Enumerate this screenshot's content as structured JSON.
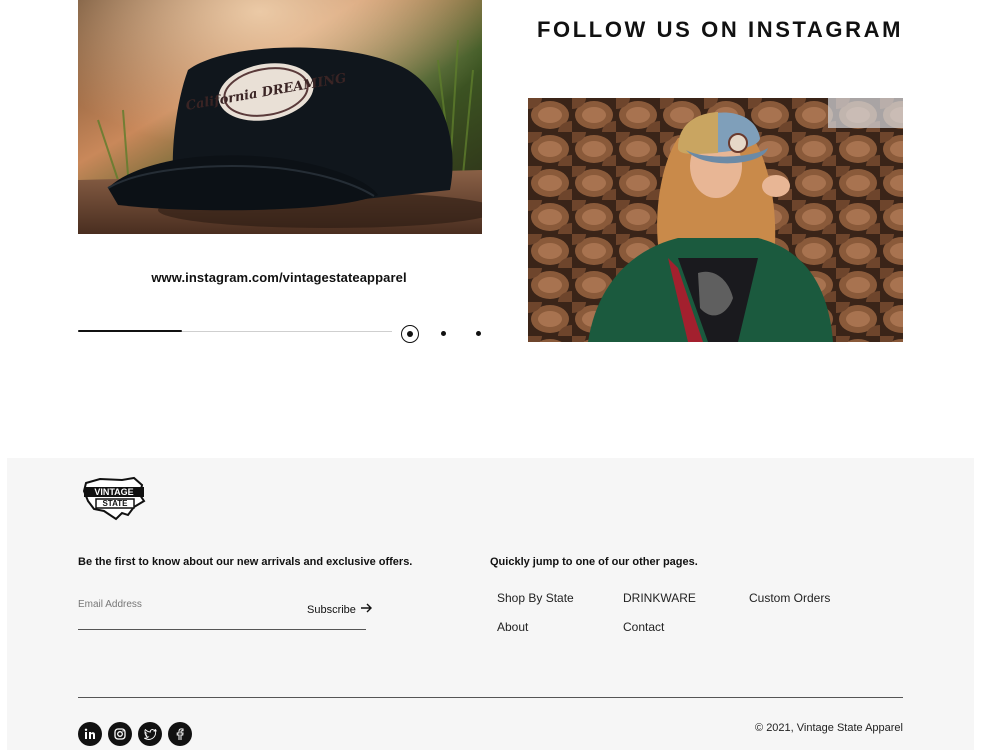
{
  "instagram": {
    "heading": "FOLLOW US ON INSTAGRAM",
    "url_text": "www.instagram.com/vintagestateapparel",
    "hat_image_alt": "California Dreaming black cap",
    "hat_patch_text": "California DREAMING",
    "woman_image_alt": "Woman wearing trucker hat in front of woodpile",
    "slider_progress": 0.33,
    "slide_count": 3,
    "active_slide": 1
  },
  "footer": {
    "logo_text": "VINTAGE STATE",
    "newsletter_heading": "Be the first to know about our new arrivals and exclusive offers.",
    "email_placeholder": "Email Address",
    "subscribe_label": "Subscribe",
    "links_heading": "Quickly jump to one of our other pages.",
    "links": [
      {
        "label": "Shop By State"
      },
      {
        "label": "DRINKWARE"
      },
      {
        "label": "Custom Orders"
      },
      {
        "label": "About"
      },
      {
        "label": "Contact"
      }
    ],
    "social": [
      {
        "icon": "linkedin-icon"
      },
      {
        "icon": "instagram-icon"
      },
      {
        "icon": "twitter-icon"
      },
      {
        "icon": "facebook-icon"
      }
    ],
    "copyright": "© 2021, Vintage State Apparel"
  },
  "colors": {
    "text": "#111111",
    "footer_bg": "#f6f6f6",
    "page_bg": "#ffffff"
  }
}
